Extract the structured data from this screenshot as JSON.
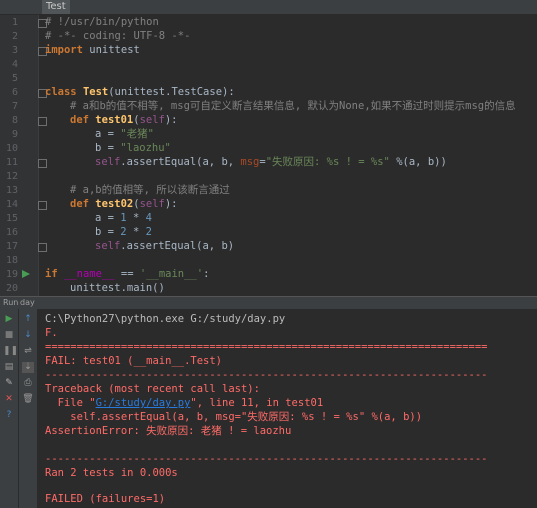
{
  "tab": {
    "title": "Test"
  },
  "editor": {
    "line_numbers": [
      "1",
      "2",
      "3",
      "4",
      "5",
      "6",
      "7",
      "8",
      "9",
      "10",
      "11",
      "12",
      "13",
      "14",
      "15",
      "16",
      "17",
      "18",
      "19",
      "20"
    ],
    "l1": "# !/usr/bin/python",
    "l2": "# -*- coding: UTF-8 -*-",
    "l3_kw": "import",
    "l3_rest": " unittest",
    "l6_kw": "class",
    "l6_name": "Test",
    "l6_rest": "(unittest.TestCase):",
    "l7": "# a和b的值不相等, msg可自定义断言结果信息, 默认为None,如果不通过时则提示msg的信息",
    "l8_kw": "def",
    "l8_name": "test01",
    "l8_open": "(",
    "l8_self": "self",
    "l8_close": "):",
    "l9_a": "a = ",
    "l9_str": "\"老猪\"",
    "l10_a": "b = ",
    "l10_str": "\"laozhu\"",
    "l11_self": "self",
    "l11_a": ".assertEqual(a, b, ",
    "l11_param": "msg",
    "l11_eq": "=",
    "l11_str": "\"失败原因: %s ! = %s\"",
    "l11_rest": " %(a, b))",
    "l13": "# a,b的值相等, 所以该断言通过",
    "l14_kw": "def",
    "l14_name": "test02",
    "l14_open": "(",
    "l14_self": "self",
    "l14_close": "):",
    "l15_a": "a = ",
    "l15_n1": "1",
    "l15_op": " * ",
    "l15_n2": "4",
    "l16_a": "b = ",
    "l16_n1": "2",
    "l16_op": " * ",
    "l16_n2": "2",
    "l17_self": "self",
    "l17_rest": ".assertEqual(a, b)",
    "l19_kw": "if",
    "l19_sp": " ",
    "l19_dn": "__name__",
    "l19_eq": " == ",
    "l19_str": "'__main__'",
    "l19_colon": ":",
    "l20": "unittest.main()"
  },
  "run_panel": {
    "label": "Run",
    "config": "day"
  },
  "console": {
    "lines": [
      "C:\\Python27\\python.exe G:/study/day.py",
      "F.",
      "======================================================================",
      "FAIL: test01 (__main__.Test)",
      "----------------------------------------------------------------------",
      "Traceback (most recent call last):",
      "  File \"",
      "G:/study/day.py",
      "\", line 11, in test01",
      "    self.assertEqual(a, b, msg=\"失败原因: %s ! = %s\" %(a, b))",
      "AssertionError: 失败原因: 老猪 ! = laozhu",
      "----------------------------------------------------------------------",
      "Ran 2 tests in 0.000s",
      "FAILED (failures=1)"
    ]
  },
  "colors": {
    "background": "#2b2b2b",
    "keyword": "#cc7832",
    "string": "#6a8759",
    "error": "#ff6b68",
    "link": "#287bde"
  }
}
